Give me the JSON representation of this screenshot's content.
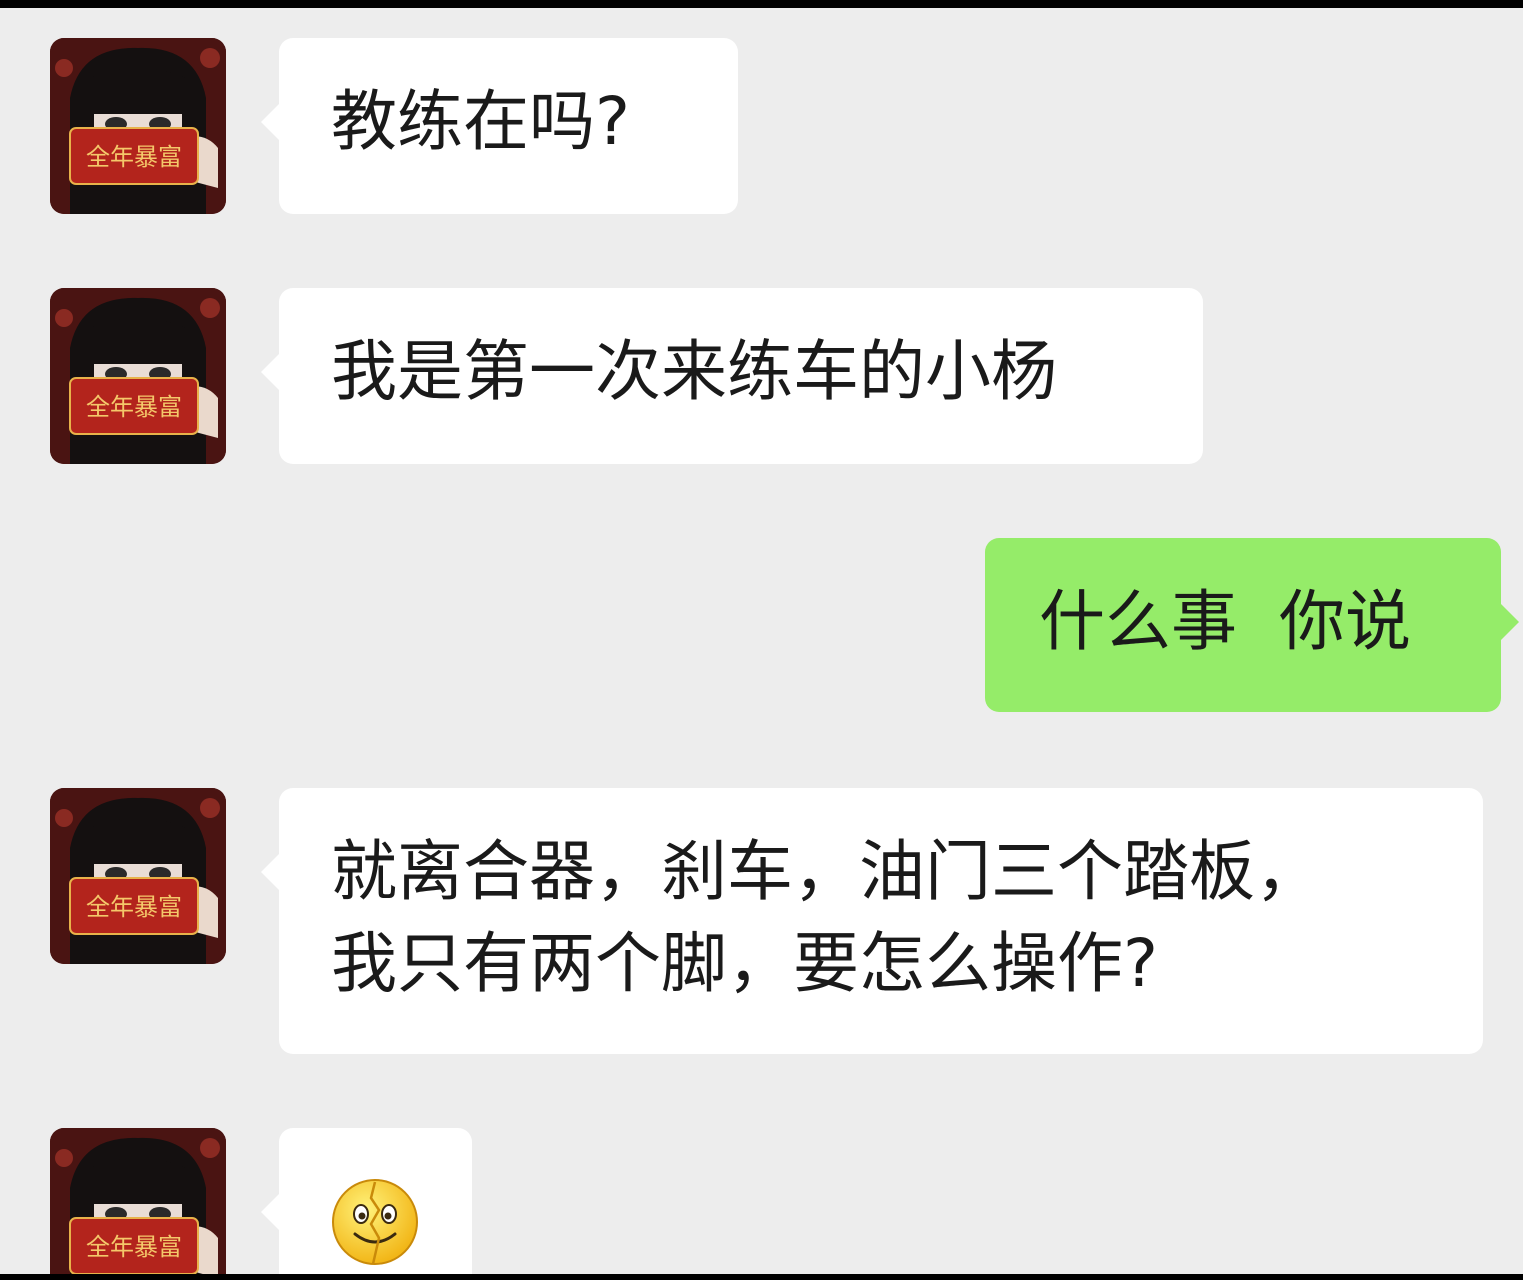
{
  "chat": {
    "avatar": {
      "label": "全年暴富",
      "colors": {
        "bg": "#4a1412",
        "card": "#b3241c",
        "cardText": "#f4c86a",
        "hair": "#141010"
      }
    },
    "colors": {
      "background": "#ededed",
      "incoming_bubble": "#ffffff",
      "outgoing_bubble": "#95ec69"
    },
    "messages": [
      {
        "direction": "incoming",
        "lines": [
          "教练在吗?"
        ]
      },
      {
        "direction": "incoming",
        "lines": [
          "我是第一次来练车的小杨"
        ]
      },
      {
        "direction": "outgoing",
        "lines": [
          "什么事  你说"
        ]
      },
      {
        "direction": "incoming",
        "lines": [
          "就离合器，刹车，油门三个踏板，",
          "我只有两个脚，要怎么操作?"
        ]
      },
      {
        "direction": "incoming",
        "emoji": "broken-heart-smile-emoji"
      }
    ]
  }
}
